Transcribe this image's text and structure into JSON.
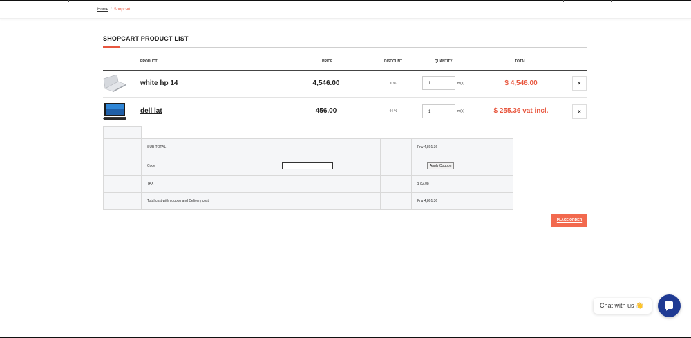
{
  "breadcrumb": {
    "home": "Home",
    "separator": "/",
    "current": "Shopcart"
  },
  "section_title": "SHOPCART PRODUCT LIST",
  "table": {
    "headers": {
      "product": "PRODUCT",
      "price": "PRICE",
      "discount": "DISCOUNT",
      "quantity": "QUANTITY",
      "total": "TOTAL"
    },
    "rows": [
      {
        "name": "white hp 14",
        "price": "4,546.00",
        "discount": "0 %",
        "quantity": "1",
        "unit": "m(s)",
        "total": "$ 4,546.00",
        "remove": "×"
      },
      {
        "name": "dell lat",
        "price": "456.00",
        "discount": "44 %",
        "quantity": "1",
        "unit": "m(s)",
        "total": "$ 255.36 vat incl.",
        "remove": "×"
      }
    ]
  },
  "summary": {
    "subtotal_label": "SUB TOTAL",
    "subtotal_value": "Frw 4,801.36",
    "code_label": "Code",
    "apply_coupon": "Apply Coupon",
    "tax_label": "TAX",
    "tax_value": "$ 82.08",
    "total_label": "Total cost with coupon and Delivery cost",
    "total_value": "Frw 4,801.36"
  },
  "place_order": "PLACE ORDER",
  "chat": {
    "label": "Chat with us 👋"
  },
  "colors": {
    "accent": "#e8573f",
    "button": "#f2694e",
    "chat": "#1f3a93"
  }
}
